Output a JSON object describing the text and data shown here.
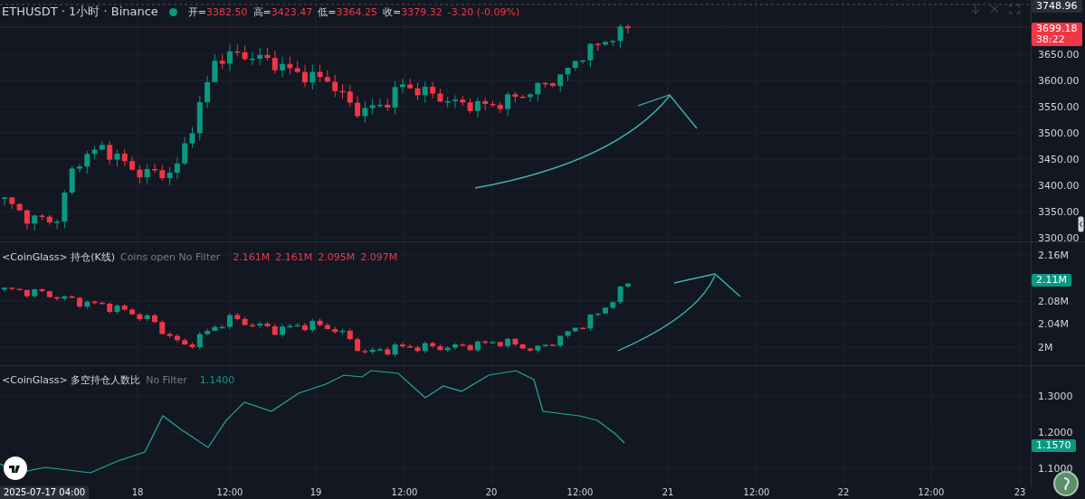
{
  "header": {
    "title": "ETHUSDT · 1小时 · Binance",
    "ohlc": [
      {
        "label": "开=",
        "value": "3382.50"
      },
      {
        "label": "高=",
        "value": "3423.47"
      },
      {
        "label": "低=",
        "value": "3364.25"
      },
      {
        "label": "收=",
        "value": "3379.32"
      }
    ],
    "change": "-3.20 (-0.09%)"
  },
  "price_axis": {
    "top_label": "3748.96",
    "last_price": "3699.18",
    "countdown": "38:22",
    "ticks": [
      "3650.00",
      "3600.00",
      "3550.00",
      "3500.00",
      "3450.00",
      "3400.00",
      "3350.00",
      "3300.00"
    ]
  },
  "oi_pane": {
    "source": "<CoinGlass>",
    "title": "持仓(K线)",
    "settings": "Coins open No Filter",
    "values": [
      "2.161M",
      "2.161M",
      "2.095M",
      "2.097M"
    ],
    "last_value": "2.11M",
    "ticks": [
      "2.16M",
      "2.08M",
      "2.04M",
      "2M"
    ]
  },
  "ratio_pane": {
    "source": "<CoinGlass>",
    "title": "多空持仓人数比",
    "settings": "No Filter",
    "value": "1.1400",
    "last_value": "1.1570",
    "ticks": [
      "1.3000",
      "1.2000",
      "1.1000"
    ]
  },
  "time_axis": {
    "cursor_label": "2025-07-17  04:00",
    "ticks": [
      "18",
      "12:00",
      "19",
      "12:00",
      "20",
      "12:00",
      "21",
      "12:00",
      "22",
      "12:00",
      "23"
    ]
  }
}
